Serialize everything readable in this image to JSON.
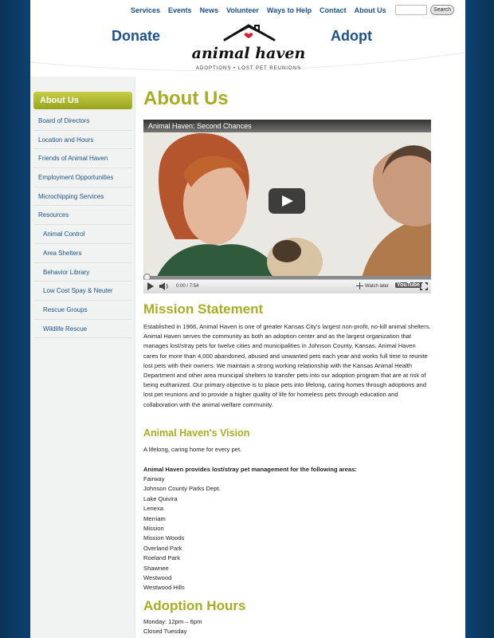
{
  "header": {
    "nav": [
      "Services",
      "Events",
      "News",
      "Volunteer",
      "Ways to Help",
      "Contact",
      "About Us"
    ],
    "search_button": "Search",
    "donate": "Donate",
    "adopt": "Adopt",
    "logo_text": "animal haven",
    "logo_tagline": "ADOPTIONS • LOST PET REUNIONS"
  },
  "sidebar": {
    "active": "About Us",
    "items": [
      {
        "label": "Board of Directors",
        "sub": false
      },
      {
        "label": "Location and Hours",
        "sub": false
      },
      {
        "label": "Friends of Animal Haven",
        "sub": false
      },
      {
        "label": "Employment Opportunities",
        "sub": false
      },
      {
        "label": "Microchipping Services",
        "sub": false
      },
      {
        "label": "Resources",
        "sub": false
      },
      {
        "label": "Animal Control",
        "sub": true
      },
      {
        "label": "Area Shelters",
        "sub": true
      },
      {
        "label": "Behavior Library",
        "sub": true
      },
      {
        "label": "Low Cost Spay & Neuter",
        "sub": true
      },
      {
        "label": "Rescue Groups",
        "sub": true
      },
      {
        "label": "Wildlife Rescue",
        "sub": true
      }
    ]
  },
  "main": {
    "title": "About Us",
    "video": {
      "title": "Animal Haven: Second Chances",
      "time": "0:00 / 7:54",
      "watch_later": "Watch later",
      "brand": "YouTube"
    },
    "mission_heading": "Mission Statement",
    "mission_text": "Established in 1966, Animal Haven is one of greater Kansas City's largest non-profit, no-kill animal shelters.  Animal Haven serves the community as both an adoption center and as the largest organization that manages lost/stray pets for twelve cities and municipalities in Johnson County, Kansas.  Animal Haven cares for more than 4,000 abandoned, abused and unwanted pets each year and works full time to reunite lost pets with their owners. We maintain a strong working relationship with the Kansas Animal Health Department and other area municipal shelters to transfer pets into our adoption program that are at risk of being euthanized. Our primary objective is to place pets into lifelong, caring homes through adoptions and lost pet reunions and to provide a higher quality of life for homeless pets through education and collaboration with the animal welfare community.",
    "vision_heading": "Animal Haven's Vision",
    "vision_text": "A lifelong, caring home for every pet.",
    "areas_heading": "Animal Haven provides lost/stray pet management for the following areas:",
    "areas": [
      "Fairway",
      "Johnson County Parks Dept.",
      "Lake Quivira",
      "Lenexa",
      "Merriam",
      "Mission",
      "Mission Woods",
      "Overland Park",
      "Roeland Park",
      "Shawnee",
      "Westwood",
      "Westwood Hills"
    ],
    "hours_heading": "Adoption Hours",
    "hours": [
      "Monday: 12pm – 6pm",
      "Closed Tuesday"
    ]
  },
  "colors": {
    "brand_blue": "#1b5190",
    "accent_green": "#a7ad23",
    "background_navy": "#0b3a66"
  }
}
